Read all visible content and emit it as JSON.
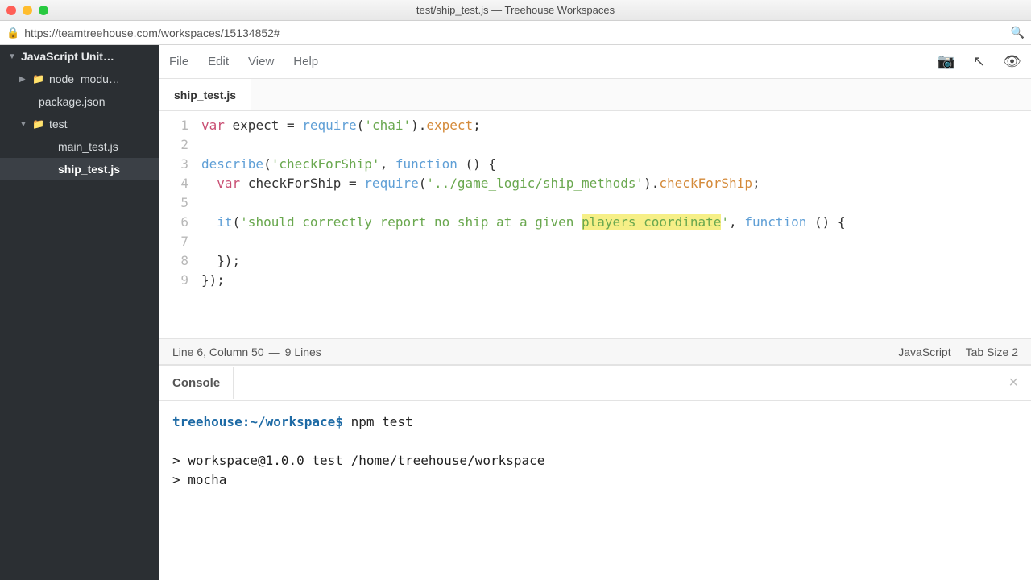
{
  "window": {
    "title": "test/ship_test.js — Treehouse Workspaces"
  },
  "address": {
    "url": "https://teamtreehouse.com/workspaces/15134852#"
  },
  "sidebar": {
    "root": "JavaScript Unit…",
    "items": [
      {
        "label": "node_modu…",
        "folder": true,
        "expanded": false
      },
      {
        "label": "package.json",
        "folder": false
      },
      {
        "label": "test",
        "folder": true,
        "expanded": true
      },
      {
        "label": "main_test.js",
        "folder": false
      },
      {
        "label": "ship_test.js",
        "folder": false,
        "selected": true
      }
    ]
  },
  "menubar": {
    "file": "File",
    "edit": "Edit",
    "view": "View",
    "help": "Help"
  },
  "tab": {
    "name": "ship_test.js"
  },
  "editor": {
    "lines": [
      "1",
      "2",
      "3",
      "4",
      "5",
      "6",
      "7",
      "8",
      "9"
    ],
    "l1": {
      "kw": "var",
      "id": " expect ",
      "eq": "= ",
      "fn": "require",
      "op": "(",
      "str": "'chai'",
      "cp": ").",
      "prop": "expect",
      "end": ";"
    },
    "l3": {
      "fn": "describe",
      "op": "(",
      "str": "'checkForShip'",
      "comma": ", ",
      "fn2": "function",
      "rest": " () {"
    },
    "l4": {
      "indent": "  ",
      "kw": "var",
      "id": " checkForShip ",
      "eq": "= ",
      "fn": "require",
      "op": "(",
      "str": "'../game_logic/ship_methods'",
      "cp": ").",
      "prop": "checkForShip",
      "end": ";"
    },
    "l6": {
      "indent": "  ",
      "fn": "it",
      "op": "(",
      "str1": "'should correctly report no ship at a given ",
      "hl": "players coordinate",
      "str2": "'",
      "comma": ", ",
      "fn2": "function",
      "rest": " () {"
    },
    "l8": {
      "text": "  });"
    },
    "l9": {
      "text": "});"
    }
  },
  "status": {
    "pos": "Line 6, Column 50",
    "sep": "—",
    "lines": "9 Lines",
    "lang": "JavaScript",
    "tab": "Tab Size",
    "tabn": "2"
  },
  "console": {
    "label": "Console",
    "host": "treehouse",
    "sep": ":",
    "path": "~/workspace",
    "dollar": "$",
    "cmd": "npm test",
    "out1": "> workspace@1.0.0 test /home/treehouse/workspace",
    "out2": "> mocha"
  }
}
